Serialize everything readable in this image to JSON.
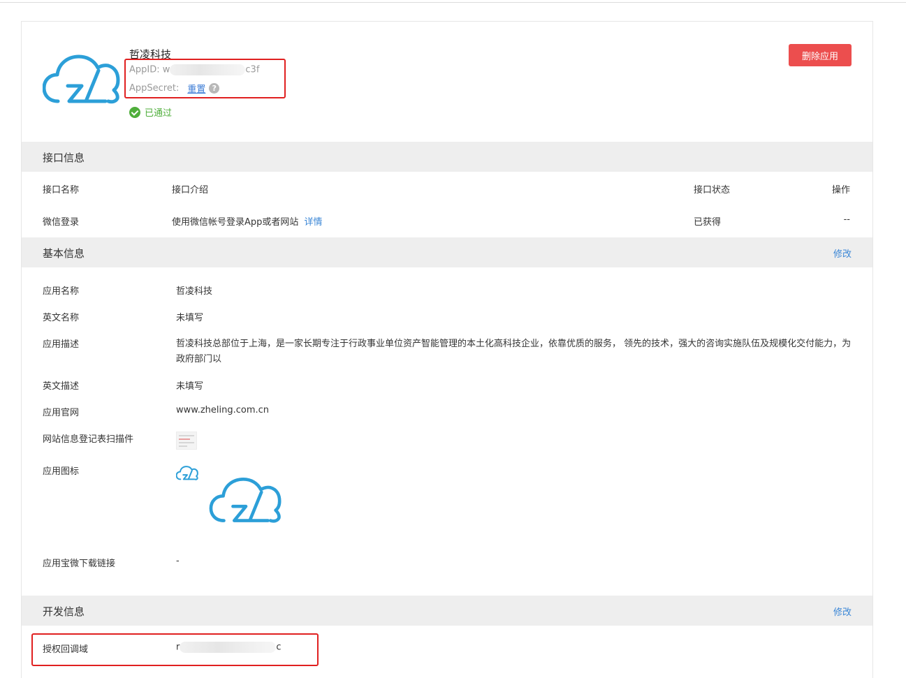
{
  "header": {
    "app_name": "哲凌科技",
    "appid_label": "AppID:",
    "appid_prefix": "w",
    "appid_suffix": "c3f",
    "appsecret_label": "AppSecret:",
    "reset_link": "重置",
    "help_glyph": "?",
    "status_text": "已通过",
    "delete_button": "删除应用"
  },
  "api_section": {
    "title": "接口信息",
    "columns": [
      "接口名称",
      "接口介绍",
      "接口状态",
      "操作"
    ],
    "rows": [
      {
        "name": "微信登录",
        "intro": "使用微信帐号登录App或者网站",
        "detail_link": "详情",
        "status": "已获得",
        "action": "--"
      }
    ]
  },
  "basic_section": {
    "title": "基本信息",
    "edit_link": "修改",
    "fields": {
      "app_name_label": "应用名称",
      "app_name_value": "哲凌科技",
      "en_name_label": "英文名称",
      "en_name_value": "未填写",
      "desc_label": "应用描述",
      "desc_value": "哲凌科技总部位于上海，是一家长期专注于行政事业单位资产智能管理的本土化高科技企业，依靠优质的服务， 领先的技术，强大的咨询实施队伍及规模化交付能力，为政府部门以",
      "en_desc_label": "英文描述",
      "en_desc_value": "未填写",
      "website_label": "应用官网",
      "website_value": "www.zheling.com.cn",
      "scan_label": "网站信息登记表扫描件",
      "icon_label": "应用图标",
      "download_label": "应用宝微下载链接",
      "download_value": "-"
    }
  },
  "dev_section": {
    "title": "开发信息",
    "edit_link": "修改",
    "callback_label": "授权回调域",
    "callback_prefix": "r",
    "callback_suffix": "c"
  },
  "colors": {
    "brand_blue": "#2c9fd8",
    "danger_red": "#ec4e4e",
    "success_green": "#4fae3b",
    "link_blue": "#3a86d6",
    "highlight_red": "#e02020"
  },
  "icons": [
    "zl-cloud-logo-icon",
    "help-circle-icon",
    "check-circle-icon",
    "scan-thumbnail-icon"
  ]
}
